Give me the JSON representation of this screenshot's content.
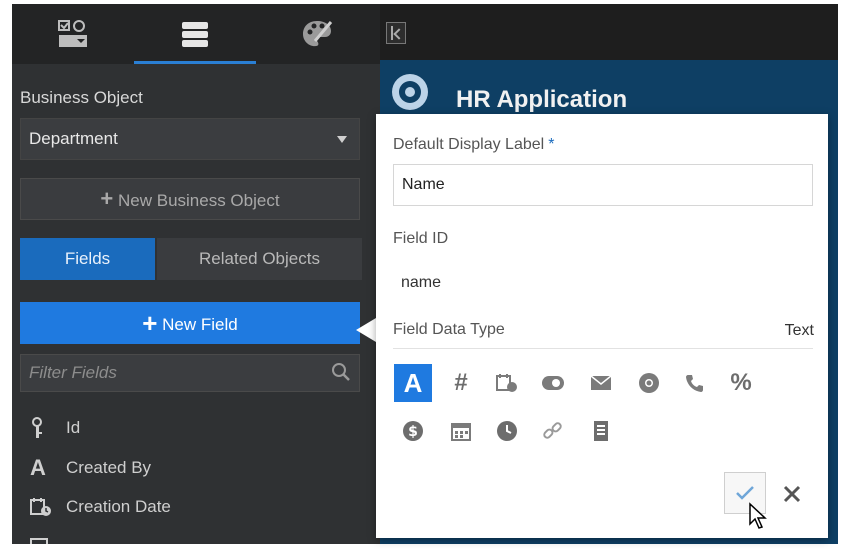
{
  "left_panel": {
    "top_tabs": [
      {
        "icon": "checklist-icon"
      },
      {
        "icon": "database-icon"
      },
      {
        "icon": "palette-icon"
      }
    ],
    "business_object_label": "Business Object",
    "business_object_value": "Department",
    "new_business_object_label": "New Business Object",
    "tabs": {
      "fields": "Fields",
      "related": "Related Objects"
    },
    "new_field_label": "New Field",
    "filter_placeholder": "Filter Fields",
    "fields": [
      {
        "label": "Id",
        "icon": "key-icon"
      },
      {
        "label": "Created By",
        "icon": "text-icon"
      },
      {
        "label": "Creation Date",
        "icon": "datetime-icon"
      }
    ]
  },
  "app": {
    "title": "HR Application"
  },
  "popup": {
    "display_label_title": "Default Display Label",
    "required_mark": "*",
    "display_label_value": "Name",
    "field_id_title": "Field ID",
    "field_id_value": "name",
    "data_type_title": "Field Data Type",
    "data_type_value": "Text",
    "type_icons_row1": [
      "A",
      "#",
      "datetime",
      "boolean",
      "email",
      "uri",
      "phone",
      "%"
    ],
    "type_icons_row2": [
      "currency",
      "calendar",
      "time",
      "link",
      "document"
    ]
  },
  "colors": {
    "accent": "#1f7ae0",
    "tab_active": "#1a6bbd",
    "header": "#0e3f64",
    "panel": "#2f3133"
  }
}
